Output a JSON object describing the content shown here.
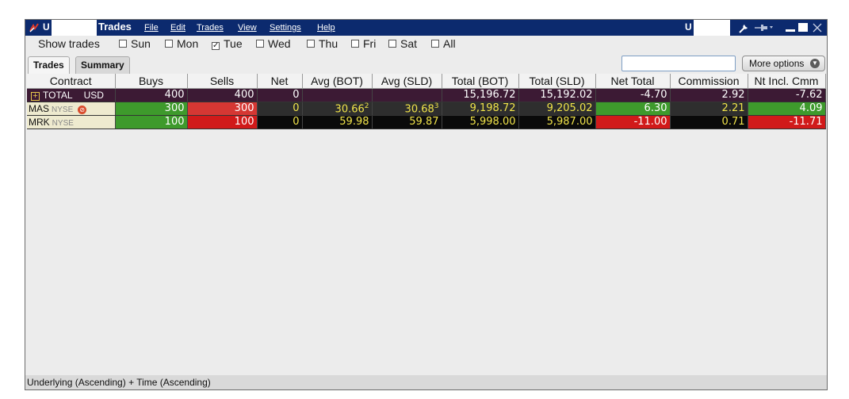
{
  "titlebar": {
    "account_left": "U",
    "title": "Trades",
    "menus": [
      "File",
      "Edit",
      "Trades",
      "View",
      "Settings",
      "Help"
    ],
    "account_right": "U",
    "icons": [
      "wrench-icon",
      "pin-icon",
      "minimize-icon",
      "maximize-icon",
      "close-icon"
    ]
  },
  "show_trades": {
    "label": "Show trades",
    "days": [
      {
        "label": "Sun",
        "checked": false
      },
      {
        "label": "Mon",
        "checked": false
      },
      {
        "label": "Tue",
        "checked": true
      },
      {
        "label": "Wed",
        "checked": false
      },
      {
        "label": "Thu",
        "checked": false
      },
      {
        "label": "Fri",
        "checked": false
      },
      {
        "label": "Sat",
        "checked": false
      },
      {
        "label": "All",
        "checked": false
      }
    ]
  },
  "tabs": [
    {
      "label": "Trades",
      "active": true
    },
    {
      "label": "Summary",
      "active": false
    }
  ],
  "search": {
    "value": ""
  },
  "more_options_label": "More options",
  "columns": [
    "Contract",
    "Buys",
    "Sells",
    "Net",
    "Avg (BOT)",
    "Avg (SLD)",
    "Total (BOT)",
    "Total (SLD)",
    "Net Total",
    "Commission",
    "Nt Incl. Cmm"
  ],
  "total_row": {
    "label": "TOTAL",
    "currency": "USD",
    "buys": "400",
    "sells": "400",
    "net": "0",
    "avg_bot": "",
    "avg_sld": "",
    "total_bot": "15,196.72",
    "total_sld": "15,192.02",
    "net_total": "-4.70",
    "commission": "2.92",
    "nt_incl_cmm": "-7.62"
  },
  "rows": [
    {
      "symbol": "MAS",
      "exchange": "NYSE",
      "buys": "300",
      "sells": "300",
      "net": "0",
      "avg_bot": "30.66",
      "avg_bot_sup": "2",
      "avg_sld": "30.68",
      "avg_sld_sup": "3",
      "total_bot": "9,198.72",
      "total_sld": "9,205.02",
      "net_total": "6.30",
      "commission": "2.21",
      "nt_incl_cmm": "4.09"
    },
    {
      "symbol": "MRK",
      "exchange": "NYSE",
      "buys": "100",
      "sells": "100",
      "net": "0",
      "avg_bot": "59.98",
      "avg_bot_sup": "",
      "avg_sld": "59.87",
      "avg_sld_sup": "",
      "total_bot": "5,998.00",
      "total_sld": "5,987.00",
      "net_total": "-11.00",
      "commission": "0.71",
      "nt_incl_cmm": "-11.71"
    }
  ],
  "footer": "Underlying (Ascending)  +  Time (Ascending)",
  "colors": {
    "titlebar": "#0c2a6e",
    "positive": "#3e9a2c",
    "negative": "#d53733",
    "value_text": "#f0e34a"
  }
}
